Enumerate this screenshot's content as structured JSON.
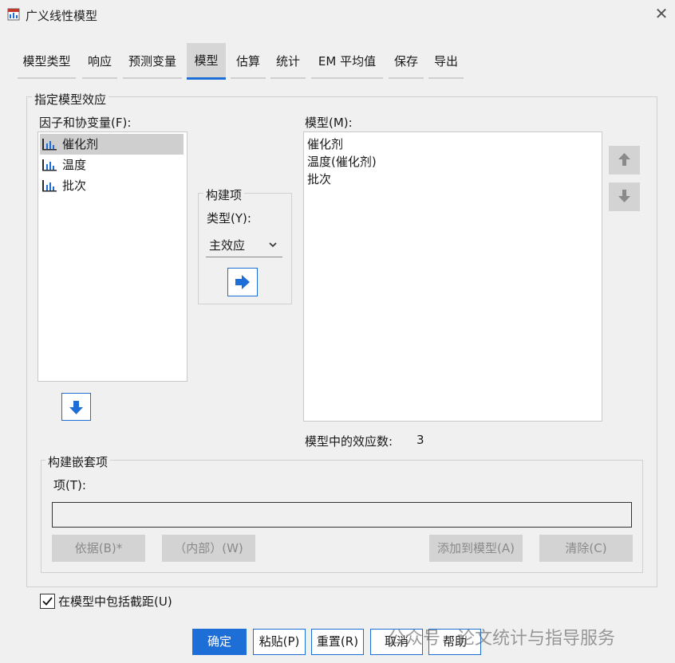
{
  "window": {
    "title": "广义线性模型",
    "close_symbol": "✕"
  },
  "tabs": [
    {
      "label": "模型类型"
    },
    {
      "label": "响应"
    },
    {
      "label": "预测变量"
    },
    {
      "label": "模型"
    },
    {
      "label": "估算"
    },
    {
      "label": "统计"
    },
    {
      "label": "EM 平均值"
    },
    {
      "label": "保存"
    },
    {
      "label": "导出"
    }
  ],
  "active_tab": "模型",
  "specify": {
    "legend": "指定模型效应"
  },
  "factors": {
    "label": "因子和协变量(F):",
    "items": [
      "催化剂",
      "温度",
      "批次"
    ],
    "selected": "催化剂"
  },
  "build": {
    "legend": "构建项",
    "type_label": "类型(Y):",
    "type_value": "主效应"
  },
  "model": {
    "label": "模型(M):",
    "items": [
      "催化剂",
      "温度(催化剂)",
      "批次"
    ],
    "effects_label": "模型中的效应数:",
    "effects_count": "3"
  },
  "nested": {
    "legend": "构建嵌套项",
    "term_label": "项(T):",
    "term_value": "",
    "by_button": "依据(B)*",
    "within_button": "（内部）(W)",
    "add_button": "添加到模型(A)",
    "clear_button": "清除(C)"
  },
  "intercept": {
    "label": "在模型中包括截距(U)",
    "checked": true
  },
  "footer": {
    "ok": "确定",
    "paste": "粘贴(P)",
    "reset": "重置(R)",
    "cancel": "取消",
    "help": "帮助"
  },
  "watermark": "公众号 · 论文统计与指导服务",
  "colors": {
    "accent": "#1e6ed8",
    "selection": "#cfcfcf",
    "disabled_button": "#d3d3d3"
  }
}
